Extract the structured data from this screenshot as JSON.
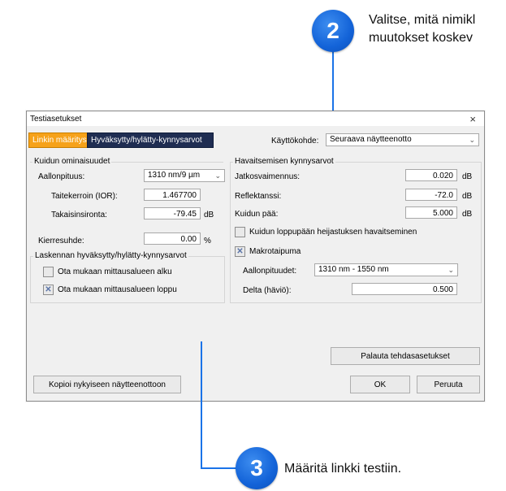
{
  "callouts": {
    "c2": {
      "number": "2",
      "text_line1": "Valitse, mitä nimikl",
      "text_line2": "muutokset koskev"
    },
    "c3": {
      "number": "3",
      "text": "Määritä linkki testiin."
    }
  },
  "colors": {
    "accent": "#1a73e8",
    "tab_active": "#f6a21a",
    "tab_inactive": "#1f2d52"
  },
  "dialog": {
    "title": "Testiasetukset",
    "close": "×",
    "tabs": [
      {
        "label": "Linkin määritys",
        "active": true
      },
      {
        "label": "Hyväksytty/hylätty-kynnysarvot",
        "active": false
      }
    ],
    "usage": {
      "label": "Käyttökohde:",
      "value": "Seuraava näytteenotto"
    },
    "fiber": {
      "title": "Kuidun ominaisuudet",
      "wavelength_label": "Aallonpituus:",
      "wavelength_value": "1310 nm/9 µm",
      "ior_label": "Taitekerroin (IOR):",
      "ior_value": "1.467700",
      "backscatter_label": "Takaisinsironta:",
      "backscatter_value": "-79.45",
      "backscatter_unit": "dB",
      "helix_label": "Kierresuhde:",
      "helix_value": "0.00",
      "helix_unit": "%"
    },
    "calc": {
      "title": "Laskennan hyväksytty/hylätty-kynnysarvot",
      "include_start": "Ota mukaan mittausalueen alku",
      "include_start_checked": false,
      "include_end": "Ota mukaan mittausalueen loppu",
      "include_end_checked": true
    },
    "detection": {
      "title": "Havaitsemisen kynnysarvot",
      "splice_label": "Jatkosvaimennus:",
      "splice_value": "0.020",
      "reflectance_label": "Reflektanssi:",
      "reflectance_value": "-72.0",
      "end_label": "Kuidun pää:",
      "end_value": "5.000",
      "unit": "dB",
      "end_reflection_label": "Kuidun loppupään heijastuksen havaitseminen",
      "end_reflection_checked": false,
      "macrobend_label": "Makrotaipuma",
      "macrobend_checked": true,
      "wavelengths_label": "Aallonpituudet:",
      "wavelengths_value": "1310 nm - 1550 nm",
      "delta_label": "Delta (häviö):",
      "delta_value": "0.500"
    },
    "buttons": {
      "restore": "Palauta tehdasasetukset",
      "copy": "Kopioi nykyiseen näytteenottoon",
      "ok": "OK",
      "cancel": "Peruuta"
    },
    "check_mark": "✕",
    "arrow": "⌄"
  }
}
